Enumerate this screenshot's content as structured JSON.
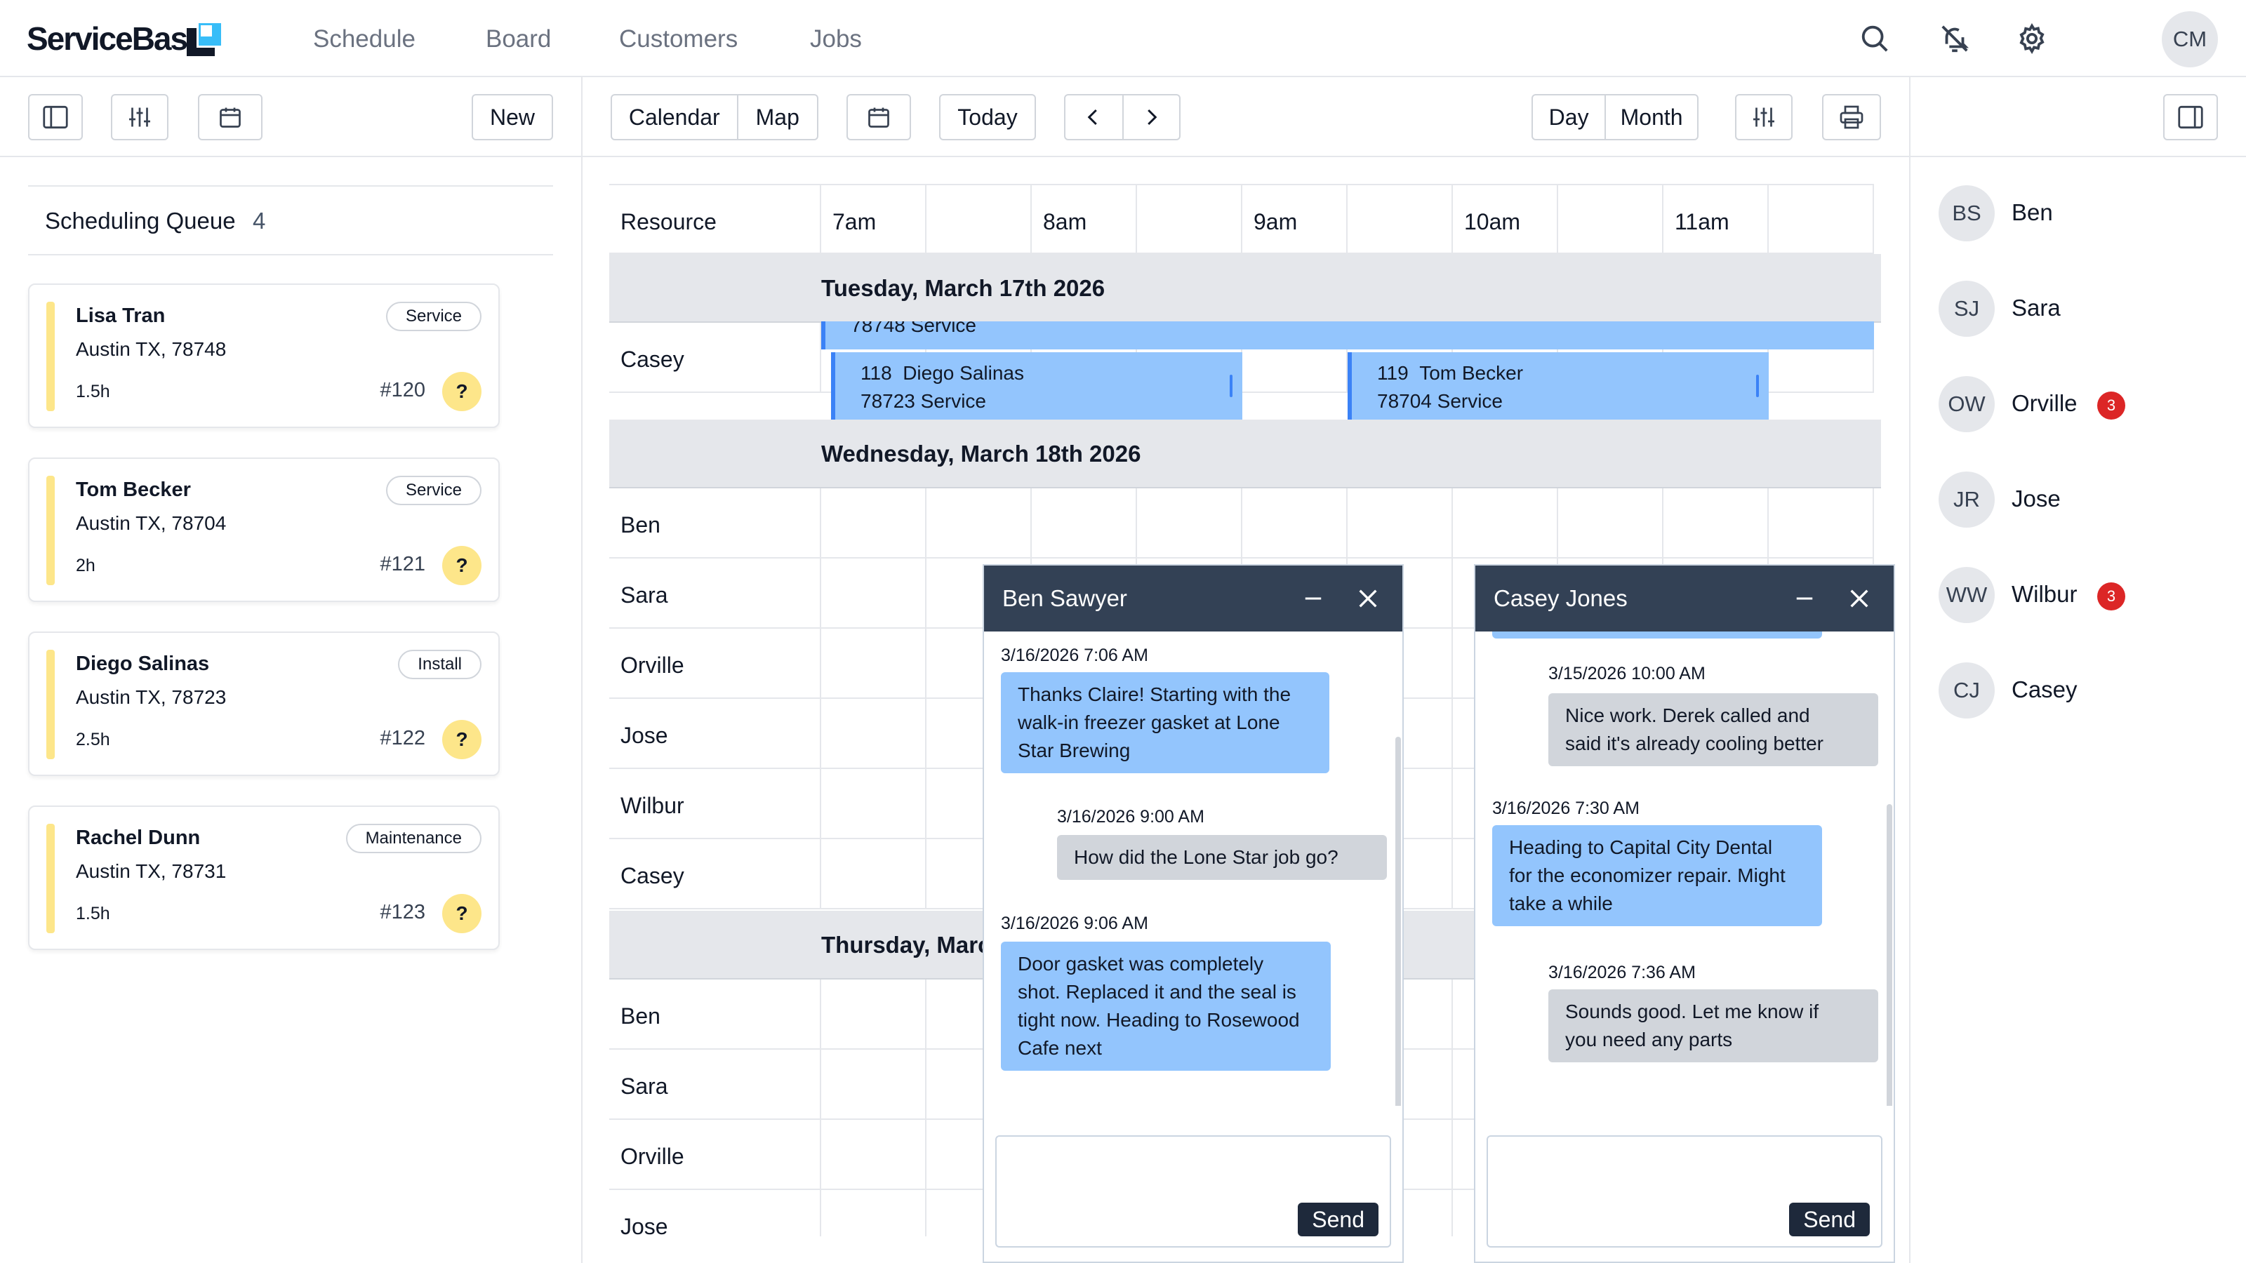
{
  "brand": {
    "name": "ServiceBase"
  },
  "nav": {
    "items": [
      "Schedule",
      "Board",
      "Customers",
      "Jobs"
    ],
    "user_initials": "CM"
  },
  "toolbar": {
    "new_label": "New",
    "views": [
      "Calendar",
      "Map"
    ],
    "today_label": "Today",
    "ranges": [
      "Day",
      "Month"
    ]
  },
  "queue": {
    "title": "Scheduling Queue",
    "count": "4",
    "cards": [
      {
        "name": "Lisa Tran",
        "address": "Austin TX, 78748",
        "duration": "1.5h",
        "number": "#120",
        "type": "Service",
        "status": "?"
      },
      {
        "name": "Tom Becker",
        "address": "Austin TX, 78704",
        "duration": "2h",
        "number": "#121",
        "type": "Service",
        "status": "?"
      },
      {
        "name": "Diego Salinas",
        "address": "Austin TX, 78723",
        "duration": "2.5h",
        "number": "#122",
        "type": "Install",
        "status": "?"
      },
      {
        "name": "Rachel Dunn",
        "address": "Austin TX, 78731",
        "duration": "1.5h",
        "number": "#123",
        "type": "Maintenance",
        "status": "?"
      }
    ]
  },
  "schedule": {
    "resource_header": "Resource",
    "hours": [
      "7am",
      "8am",
      "9am",
      "10am",
      "11am"
    ],
    "days": [
      {
        "label": "Tuesday, March 17th 2026",
        "resources": [
          "Casey"
        ]
      },
      {
        "label": "Wednesday, March 18th 2026",
        "resources": [
          "Ben",
          "Sara",
          "Orville",
          "Jose",
          "Wilbur",
          "Casey"
        ]
      },
      {
        "label": "Thursday, March",
        "resources": [
          "Ben",
          "Sara",
          "Orville",
          "Jose"
        ]
      }
    ],
    "events": [
      {
        "line1": "",
        "line2": "78748 Service"
      },
      {
        "number": "118",
        "name": "Diego Salinas",
        "line2": "78723 Service"
      },
      {
        "number": "119",
        "name": "Tom Becker",
        "line2": "78704 Service"
      }
    ]
  },
  "chats": [
    {
      "title": "Ben Sawyer",
      "send_label": "Send",
      "messages": [
        {
          "time": "3/16/2026 7:06 AM",
          "text": "Thanks Claire! Starting with the walk-in freezer gasket at Lone Star Brewing",
          "lines": [
            "Thanks Claire! Starting with the",
            "walk-in freezer gasket at Lone",
            "Star Brewing"
          ]
        },
        {
          "time": "3/16/2026 9:00 AM",
          "text": "How did the Lone Star job go?",
          "lines": [
            "How did the Lone Star job go?"
          ]
        },
        {
          "time": "3/16/2026 9:06 AM",
          "text": "Door gasket was completely shot. Replaced it and the seal is tight now. Heading to Rosewood Cafe next",
          "lines": [
            "Door gasket was completely",
            "shot. Replaced it and the seal is",
            "tight now. Heading to Rosewood",
            "Cafe next"
          ]
        }
      ]
    },
    {
      "title": "Casey Jones",
      "send_label": "Send",
      "messages": [
        {
          "time": "3/15/2026 10:00 AM",
          "text": "Nice work. Derek called and said it's already cooling better",
          "lines": [
            "Nice work. Derek called and",
            "said it's already cooling better"
          ]
        },
        {
          "time": "3/16/2026 7:30 AM",
          "text": "Heading to Capital City Dental for the economizer repair. Might take a while",
          "lines": [
            "Heading to Capital City Dental",
            "for the economizer repair. Might",
            "take a while"
          ]
        },
        {
          "time": "3/16/2026 7:36 AM",
          "text": "Sounds good. Let me know if you need any parts",
          "lines": [
            "Sounds good. Let me know if",
            "you need any parts"
          ]
        }
      ]
    }
  ],
  "resources": [
    {
      "initials": "BS",
      "name": "Ben",
      "count": ""
    },
    {
      "initials": "SJ",
      "name": "Sara",
      "count": ""
    },
    {
      "initials": "OW",
      "name": "Orville",
      "count": "3"
    },
    {
      "initials": "JR",
      "name": "Jose",
      "count": ""
    },
    {
      "initials": "WW",
      "name": "Wilbur",
      "count": "3"
    },
    {
      "initials": "CJ",
      "name": "Casey",
      "count": ""
    }
  ],
  "colors": {
    "accent": "#93c5fd",
    "accent_border": "#3b82f6",
    "queue_bar": "#fde68a",
    "chat_header": "#334155",
    "badge_red": "#dc2626"
  },
  "icons": [
    "search-icon",
    "bell-off-icon",
    "gear-icon",
    "sidebar-toggle-icon",
    "sliders-icon",
    "calendar-icon",
    "chevron-left-icon",
    "chevron-right-icon",
    "printer-icon",
    "panel-right-icon",
    "minimize-icon",
    "close-icon"
  ]
}
